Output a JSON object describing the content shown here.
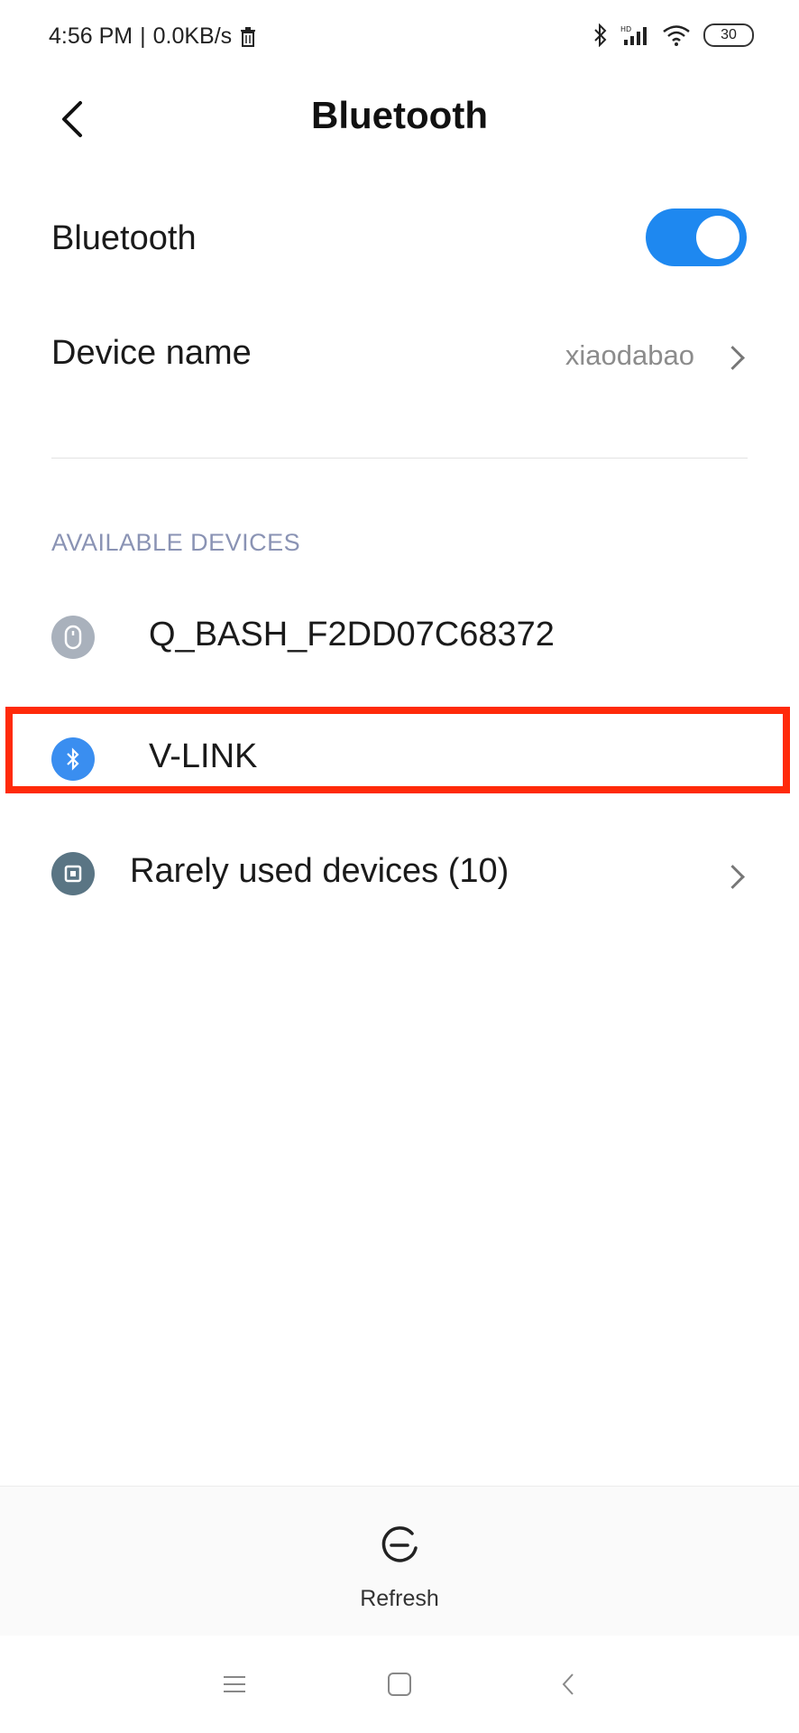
{
  "status_bar": {
    "time": "4:56 PM",
    "separator": "|",
    "net_speed": "0.0KB/s",
    "battery": "30"
  },
  "header": {
    "title": "Bluetooth"
  },
  "bluetooth_toggle": {
    "label": "Bluetooth",
    "state": "on",
    "accent": "#1e88f0"
  },
  "device_name": {
    "label": "Device name",
    "value": "xiaodabao"
  },
  "available_devices": {
    "header": "AVAILABLE DEVICES",
    "items": [
      {
        "label": "Q_BASH_F2DD07C68372",
        "icon": "mouse-icon"
      },
      {
        "label": "V-LINK",
        "icon": "bluetooth-icon"
      },
      {
        "label": "Rarely used devices (10)",
        "icon": "device-group-icon"
      }
    ]
  },
  "refresh": {
    "label": "Refresh"
  },
  "colors": {
    "highlight": "#ff2a0a",
    "section_header": "#8a93b4"
  }
}
